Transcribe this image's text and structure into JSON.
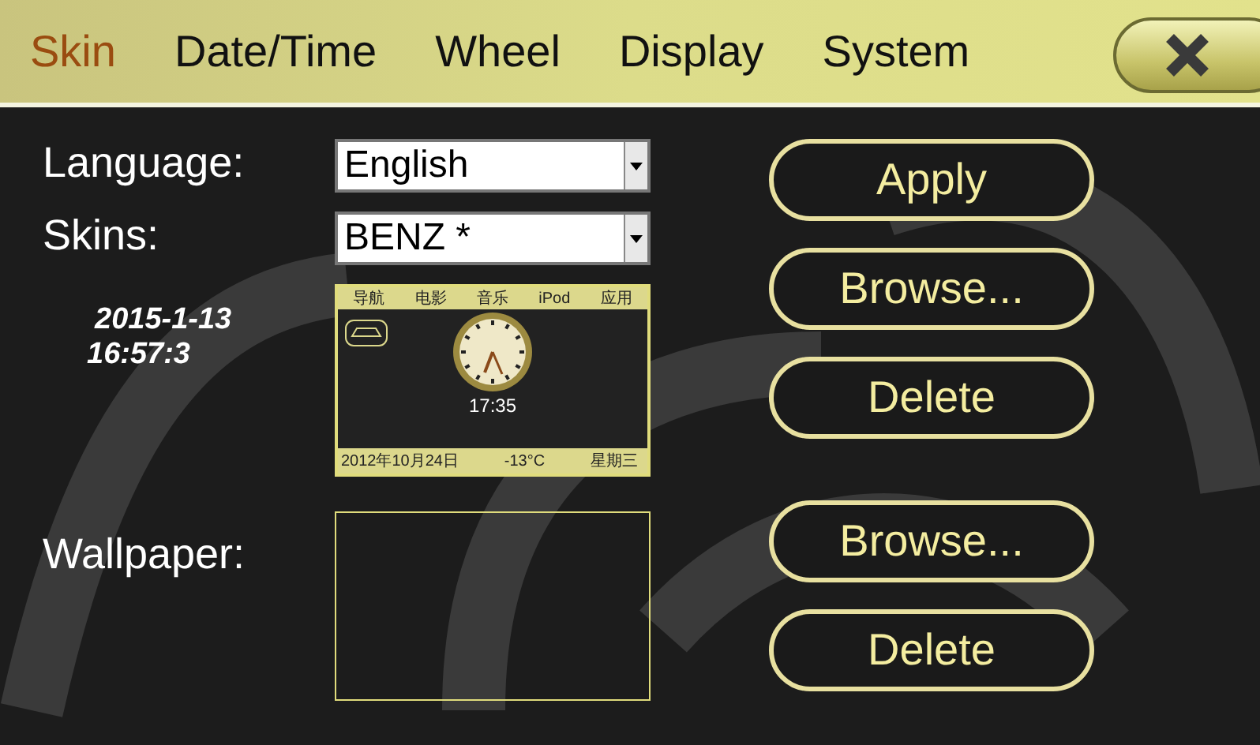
{
  "tabs": [
    {
      "label": "Skin",
      "selected": true
    },
    {
      "label": "Date/Time",
      "selected": false
    },
    {
      "label": "Wheel",
      "selected": false
    },
    {
      "label": "Display",
      "selected": false
    },
    {
      "label": "System",
      "selected": false
    }
  ],
  "language": {
    "label": "Language:",
    "value": "English"
  },
  "skins": {
    "label": "Skins:",
    "value": "BENZ *"
  },
  "datetime": {
    "date": "2015-1-13",
    "time": "16:57:3"
  },
  "skin_preview": {
    "menu": [
      "导航",
      "电影",
      "音乐",
      "iPod",
      "应用"
    ],
    "clock_time": "17:35",
    "date": "2012年10月24日",
    "temperature": "-13°C",
    "weekday": "星期三"
  },
  "wallpaper": {
    "label": "Wallpaper:"
  },
  "skin_buttons": [
    "Apply",
    "Browse...",
    "Delete"
  ],
  "wallpaper_buttons": [
    "Browse...",
    "Delete"
  ]
}
